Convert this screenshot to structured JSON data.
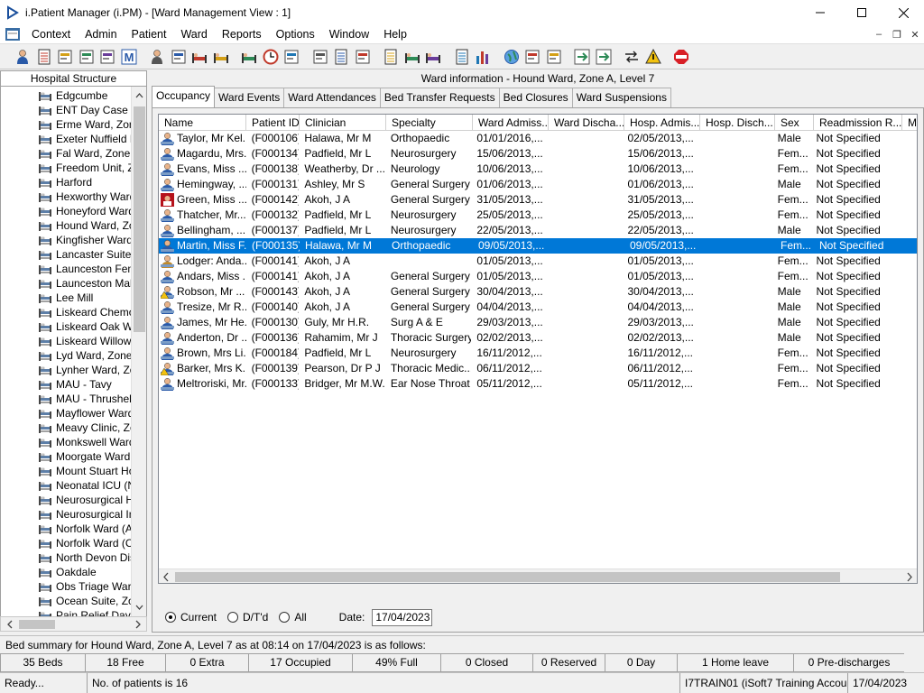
{
  "window": {
    "title": "i.Patient Manager (i.PM) - [Ward Management View : 1]",
    "controls": [
      "minimize",
      "maximize",
      "close"
    ]
  },
  "menu": {
    "items": [
      "Context",
      "Admin",
      "Patient",
      "Ward",
      "Reports",
      "Options",
      "Window",
      "Help"
    ],
    "mdi_controls": [
      "minimize",
      "restore",
      "close"
    ]
  },
  "toolbar": {
    "buttons": [
      "patient-search-icon",
      "printer-icon",
      "record-icon",
      "edit-form-icon",
      "form-list-icon",
      "ward-m-icon",
      "person-icon",
      "document-edit-icon",
      "admission-bed-icon",
      "transfer-bed-icon",
      "bed-cancel-icon",
      "clock-icon",
      "screen-icon",
      "report-icon",
      "notes-icon",
      "history-icon",
      "list-icon",
      "bed-icon",
      "bed-transfer-icon",
      "page-icon",
      "bar-chart-icon",
      "globe-icon",
      "check-list-icon",
      "check-list-2-icon",
      "green-arrow-icon",
      "refresh-icon",
      "swap-icon",
      "warning-icon",
      "exit-icon"
    ]
  },
  "left_panel": {
    "header": "Hospital Structure",
    "items": [
      "Edgcumbe",
      "ENT Day Case U",
      "Erme Ward, Zone",
      "Exeter Nuffield H",
      "Fal Ward, Zone E",
      "Freedom Unit, Zo",
      "Harford",
      "Hexworthy Ward,",
      "Honeyford Ward,",
      "Hound Ward, Zo",
      "Kingfisher Ward",
      "Lancaster Suite, Z",
      "Launceston Fema",
      "Launceston Male",
      "Lee Mill",
      "Liskeard Chemo D",
      "Liskeard Oak Wa",
      "Liskeard Willow V",
      "Lyd Ward, Zone I",
      "Lynher Ward, Zon",
      "MAU - Tavy",
      "MAU - Thrushel",
      "Mayflower Ward,",
      "Meavy Clinic, Zon",
      "Monkswell Ward,",
      "Moorgate Ward, Z",
      "Mount Stuart Hos",
      "Neonatal ICU (NI",
      "Neurosurgical Hig",
      "Neurosurgical Inte",
      "Norfolk Ward (Ad",
      "Norfolk Ward (Co",
      "North Devon Dist",
      "Oakdale",
      "Obs Triage Ward",
      "Ocean Suite, Zor",
      "Pain Relief Day C"
    ]
  },
  "ward_info": "Ward information - Hound Ward, Zone A, Level 7",
  "tabs": [
    "Occupancy",
    "Ward Events",
    "Ward Attendances",
    "Bed Transfer Requests",
    "Bed Closures",
    "Ward Suspensions"
  ],
  "grid": {
    "columns": [
      "Name",
      "Patient ID",
      "Clinician",
      "Specialty",
      "Ward Admiss...",
      "Ward Discha...",
      "Hosp. Admis...",
      "Hosp. Disch...",
      "Sex",
      "Readmission R...",
      "M"
    ],
    "selected_row": 7,
    "rows": [
      {
        "icon": "patient",
        "cells": [
          "Taylor, Mr Kel...",
          "(F000106)",
          "Halawa, Mr M",
          "Orthopaedic",
          "01/01/2016,...",
          "",
          "02/05/2013,...",
          "",
          "Male",
          "Not Specified"
        ]
      },
      {
        "icon": "patient",
        "cells": [
          "Magardu, Mrs...",
          "(F000134)",
          "Padfield, Mr L",
          "Neurosurgery",
          "15/06/2013,...",
          "",
          "15/06/2013,...",
          "",
          "Fem...",
          "Not Specified"
        ]
      },
      {
        "icon": "patient",
        "cells": [
          "Evans, Miss ...",
          "(F000138)",
          "Weatherby, Dr ...",
          "Neurology",
          "10/06/2013,...",
          "",
          "10/06/2013,...",
          "",
          "Fem...",
          "Not Specified"
        ]
      },
      {
        "icon": "patient",
        "cells": [
          "Hemingway, ...",
          "(F000131)",
          "Ashley, Mr S",
          "General Surgery",
          "01/06/2013,...",
          "",
          "01/06/2013,...",
          "",
          "Male",
          "Not Specified"
        ]
      },
      {
        "icon": "patient-alert",
        "cells": [
          "Green, Miss ...",
          "(F000142)",
          "Akoh, J A",
          "General Surgery",
          "31/05/2013,...",
          "",
          "31/05/2013,...",
          "",
          "Fem...",
          "Not Specified"
        ]
      },
      {
        "icon": "patient",
        "cells": [
          "Thatcher, Mr...",
          "(F000132)",
          "Padfield, Mr L",
          "Neurosurgery",
          "25/05/2013,...",
          "",
          "25/05/2013,...",
          "",
          "Fem...",
          "Not Specified"
        ]
      },
      {
        "icon": "patient",
        "cells": [
          "Bellingham, ...",
          "(F000137)",
          "Padfield, Mr L",
          "Neurosurgery",
          "22/05/2013,...",
          "",
          "22/05/2013,...",
          "",
          "Male",
          "Not Specified"
        ]
      },
      {
        "icon": "patient",
        "cells": [
          "Martin, Miss F...",
          "(F000135)",
          "Halawa, Mr M",
          "Orthopaedic",
          "09/05/2013,...",
          "",
          "09/05/2013,...",
          "",
          "Fem...",
          "Not Specified"
        ]
      },
      {
        "icon": "lodger",
        "cells": [
          "Lodger: Anda...",
          "(F000141)",
          "Akoh, J A",
          "",
          "01/05/2013,...",
          "",
          "01/05/2013,...",
          "",
          "Fem...",
          "Not Specified"
        ]
      },
      {
        "icon": "patient",
        "cells": [
          "Andars, Miss ...",
          "(F000141)",
          "Akoh, J A",
          "General Surgery",
          "01/05/2013,...",
          "",
          "01/05/2013,...",
          "",
          "Fem...",
          "Not Specified"
        ]
      },
      {
        "icon": "patient-warning",
        "cells": [
          "Robson, Mr ...",
          "(F000143)",
          "Akoh, J A",
          "General Surgery",
          "30/04/2013,...",
          "",
          "30/04/2013,...",
          "",
          "Male",
          "Not Specified"
        ]
      },
      {
        "icon": "patient",
        "cells": [
          "Tresize, Mr R...",
          "(F000140)",
          "Akoh, J A",
          "General Surgery",
          "04/04/2013,...",
          "",
          "04/04/2013,...",
          "",
          "Male",
          "Not Specified"
        ]
      },
      {
        "icon": "patient",
        "cells": [
          "James, Mr He...",
          "(F000130)",
          "Guly, Mr H.R.",
          "Surg A & E",
          "29/03/2013,...",
          "",
          "29/03/2013,...",
          "",
          "Male",
          "Not Specified"
        ]
      },
      {
        "icon": "patient",
        "cells": [
          "Anderton, Dr ...",
          "(F000136)",
          "Rahamim, Mr J",
          "Thoracic Surgery",
          "02/02/2013,...",
          "",
          "02/02/2013,...",
          "",
          "Male",
          "Not Specified"
        ]
      },
      {
        "icon": "patient",
        "cells": [
          "Brown, Mrs Li...",
          "(F000184)",
          "Padfield, Mr L",
          "Neurosurgery",
          "16/11/2012,...",
          "",
          "16/11/2012,...",
          "",
          "Fem...",
          "Not Specified"
        ]
      },
      {
        "icon": "patient-warning",
        "cells": [
          "Barker, Mrs K...",
          "(F000139)",
          "Pearson, Dr P J",
          "Thoracic Medic...",
          "06/11/2012,...",
          "",
          "06/11/2012,...",
          "",
          "Fem...",
          "Not Specified"
        ]
      },
      {
        "icon": "patient",
        "cells": [
          "Meltroriski, Mr...",
          "(F000133)",
          "Bridger, Mr M.W.",
          "Ear Nose Throat",
          "05/11/2012,...",
          "",
          "05/11/2012,...",
          "",
          "Fem...",
          "Not Specified"
        ]
      }
    ]
  },
  "filter": {
    "options": [
      "Current",
      "D/T'd",
      "All"
    ],
    "selected": "Current",
    "date_label": "Date:",
    "date_value": "17/04/2023"
  },
  "bed_summary": "Bed summary for Hound Ward, Zone A, Level 7 as at 08:14 on 17/04/2023 is as follows:",
  "stats": [
    "35 Beds",
    "18 Free",
    "0 Extra",
    "17 Occupied",
    "49% Full",
    "0 Closed",
    "0 Reserved",
    "0 Day",
    "1 Home leave",
    "0 Pre-discharges"
  ],
  "status": {
    "left": "Ready...",
    "patients": "No. of patients is 16",
    "account": "I7TRAIN01 (iSoft7 Training Account)",
    "date": "17/04/2023"
  },
  "colors": {
    "selection": "#0078d7",
    "window_bg": "#f0f0f0"
  }
}
